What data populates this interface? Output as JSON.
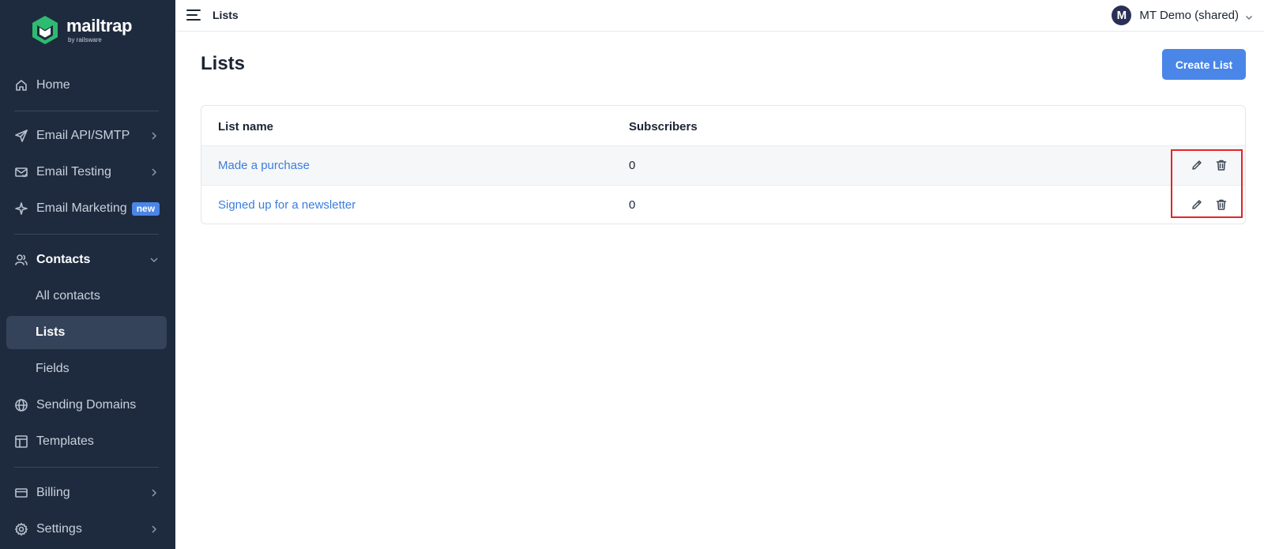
{
  "app": {
    "brand": "mailtrap",
    "brand_sub": "by railsware"
  },
  "sidebar": {
    "items": [
      {
        "label": "Home",
        "icon": "home-icon"
      },
      {
        "label": "Email API/SMTP",
        "icon": "send-icon"
      },
      {
        "label": "Email Testing",
        "icon": "email-check-icon"
      },
      {
        "label": "Email Marketing",
        "icon": "sparkle-icon",
        "badge": "new"
      },
      {
        "label": "Contacts",
        "icon": "users-icon",
        "expanded": true
      },
      {
        "label": "All contacts"
      },
      {
        "label": "Lists",
        "active": true
      },
      {
        "label": "Fields"
      },
      {
        "label": "Sending Domains",
        "icon": "globe-icon"
      },
      {
        "label": "Templates",
        "icon": "template-icon"
      },
      {
        "label": "Billing",
        "icon": "card-icon"
      },
      {
        "label": "Settings",
        "icon": "gear-icon"
      }
    ]
  },
  "topbar": {
    "breadcrumb": "Lists",
    "account_initial": "M",
    "account_name": "MT Demo (shared)"
  },
  "main": {
    "title": "Lists",
    "create_button": "Create List",
    "table": {
      "columns": [
        "List name",
        "Subscribers"
      ],
      "rows": [
        {
          "name": "Made a purchase",
          "subscribers": "0"
        },
        {
          "name": "Signed up for a newsletter",
          "subscribers": "0"
        }
      ]
    }
  },
  "colors": {
    "sidebar_bg": "#1e2b3f",
    "accent": "#4a86e8",
    "link": "#3b7ddd",
    "highlight": "#e3242b"
  }
}
